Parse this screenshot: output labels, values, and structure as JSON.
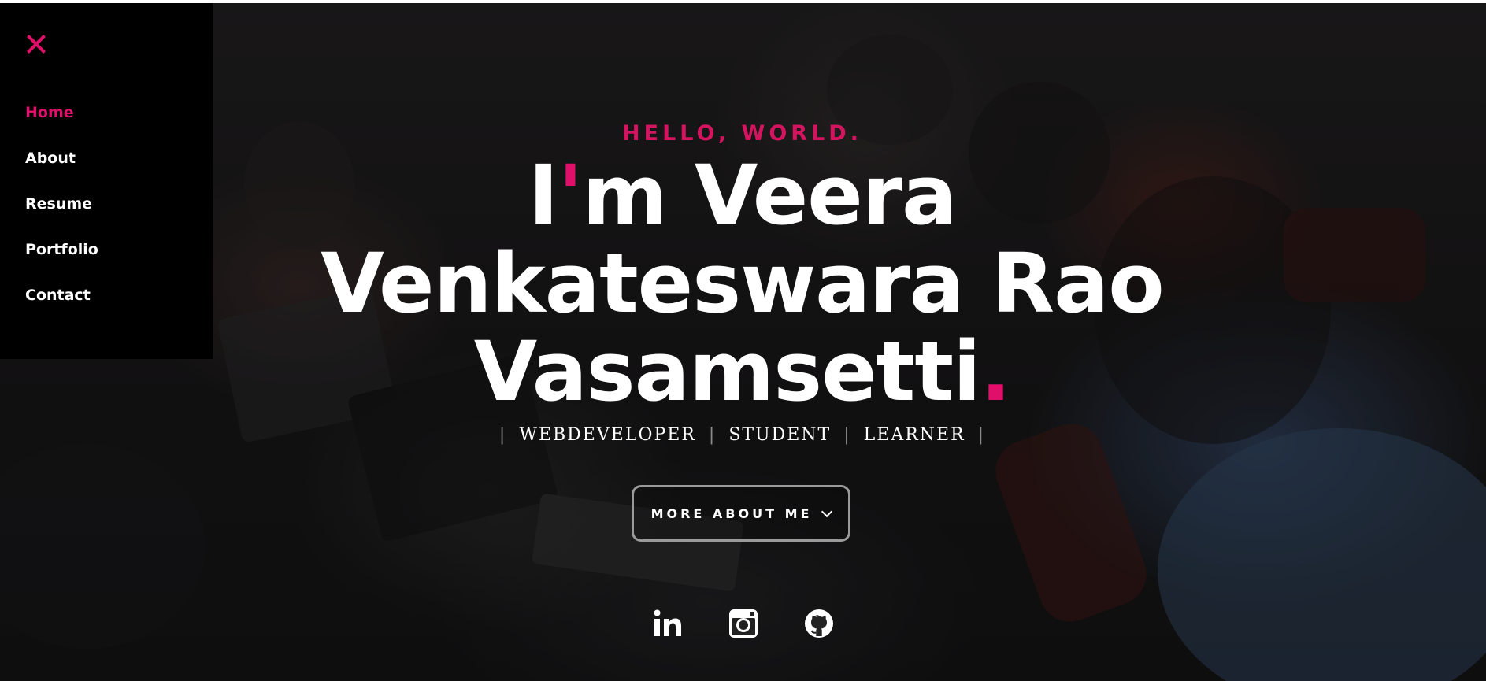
{
  "menu": {
    "items": [
      {
        "label": "Home"
      },
      {
        "label": "About"
      },
      {
        "label": "Resume"
      },
      {
        "label": "Portfolio"
      },
      {
        "label": "Contact"
      }
    ]
  },
  "hero": {
    "greeting": "HELLO, WORLD.",
    "headline_line1_pre": "I",
    "headline_line1_tick": "'",
    "headline_line1_post": "m Veera",
    "headline_line2": "Venkateswara Rao",
    "headline_line3": "Vasamsetti",
    "headline_dot": ".",
    "roles": [
      "WEBDEVELOPER",
      "STUDENT",
      "LEARNER"
    ],
    "separator": "|",
    "cta_label": "MORE ABOUT ME"
  },
  "socials": [
    {
      "icon": "linkedin-icon"
    },
    {
      "icon": "instagram-icon"
    },
    {
      "icon": "github-icon"
    }
  ],
  "colors": {
    "accent": "#e0106a",
    "greeting": "#d4145f",
    "menu_bg": "#000000",
    "text": "#ffffff"
  }
}
